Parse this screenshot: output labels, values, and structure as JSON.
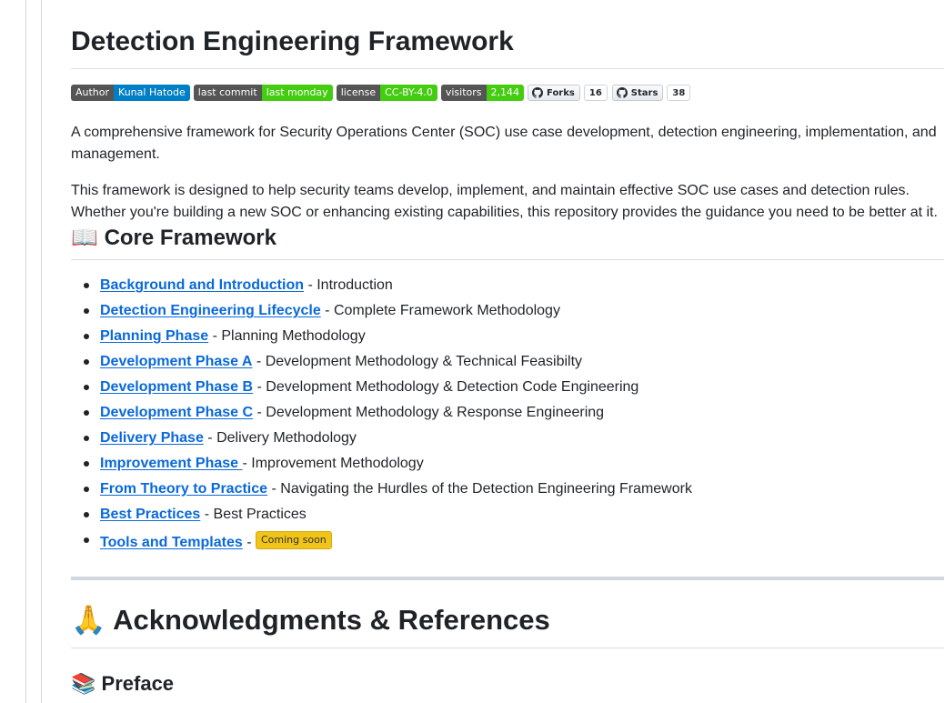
{
  "title": "Detection Engineering Framework",
  "badges": {
    "author": {
      "label": "Author",
      "value": "Kunal Hatode",
      "color": "#007ec6"
    },
    "commit": {
      "label": "last commit",
      "value": "last monday",
      "color": "#4c1"
    },
    "license": {
      "label": "license",
      "value": "CC-BY-4.0",
      "color": "#4c1"
    },
    "visitors": {
      "label": "visitors",
      "value": "2,144",
      "color": "#4c1"
    },
    "forks": {
      "label": "Forks",
      "count": "16"
    },
    "stars": {
      "label": "Stars",
      "count": "38"
    }
  },
  "intro": {
    "p1": "A comprehensive framework for Security Operations Center (SOC) use case development, detection engineering, implementation, and management.",
    "p2": "This framework is designed to help security teams develop, implement, and maintain effective SOC use cases and detection rules. Whether you're building a new SOC or enhancing existing capabilities, this repository provides the guidance you need to be better at it."
  },
  "core": {
    "emoji": "📖",
    "heading": "Core Framework",
    "items": [
      {
        "link": "Background and Introduction",
        "desc": " - Introduction"
      },
      {
        "link": "Detection Engineering Lifecycle",
        "desc": " - Complete Framework Methodology"
      },
      {
        "link": "Planning Phase",
        "desc": " - Planning Methodology"
      },
      {
        "link": "Development Phase A",
        "desc": " - Development Methodology & Technical Feasibilty"
      },
      {
        "link": "Development Phase B",
        "desc": " - Development Methodology & Detection Code Engineering"
      },
      {
        "link": "Development Phase C",
        "desc": " - Development Methodology & Response Engineering"
      },
      {
        "link": "Delivery Phase",
        "desc": " - Delivery Methodology"
      },
      {
        "link": "Improvement Phase ",
        "desc": "- Improvement Methodology"
      },
      {
        "link": "From Theory to Practice",
        "desc": " - Navigating the Hurdles of the Detection Engineering Framework"
      },
      {
        "link": "Best Practices",
        "desc": " - Best Practices"
      }
    ],
    "last": {
      "link": "Tools and Templates",
      "desc": " - ",
      "badge": "Coming soon",
      "badge_color": "#f0c419"
    }
  },
  "ack": {
    "emoji": "🙏",
    "heading": "Acknowledgments & References"
  },
  "preface": {
    "emoji": "📚",
    "heading": "Preface"
  },
  "colors": {
    "link": "#0969da",
    "text": "#1f2328",
    "rule": "#d0d7de"
  }
}
